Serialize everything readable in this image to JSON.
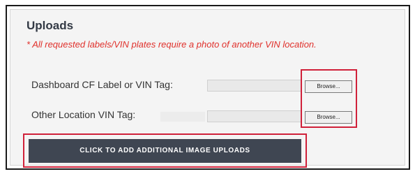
{
  "uploads": {
    "title": "Uploads",
    "note": "* All requested labels/VIN plates require a photo of another VIN location.",
    "rows": [
      {
        "label": "Dashboard CF Label or VIN Tag:",
        "value": "",
        "button": "Browse..."
      },
      {
        "label": "Other Location VIN Tag:",
        "value": "",
        "button": "Browse..."
      }
    ],
    "add_button_label": "CLICK TO ADD ADDITIONAL IMAGE UPLOADS"
  },
  "colors": {
    "note_red": "#e0312c",
    "highlight_red": "#d0213a",
    "cta_background": "#3f4652",
    "title": "#333a45"
  }
}
